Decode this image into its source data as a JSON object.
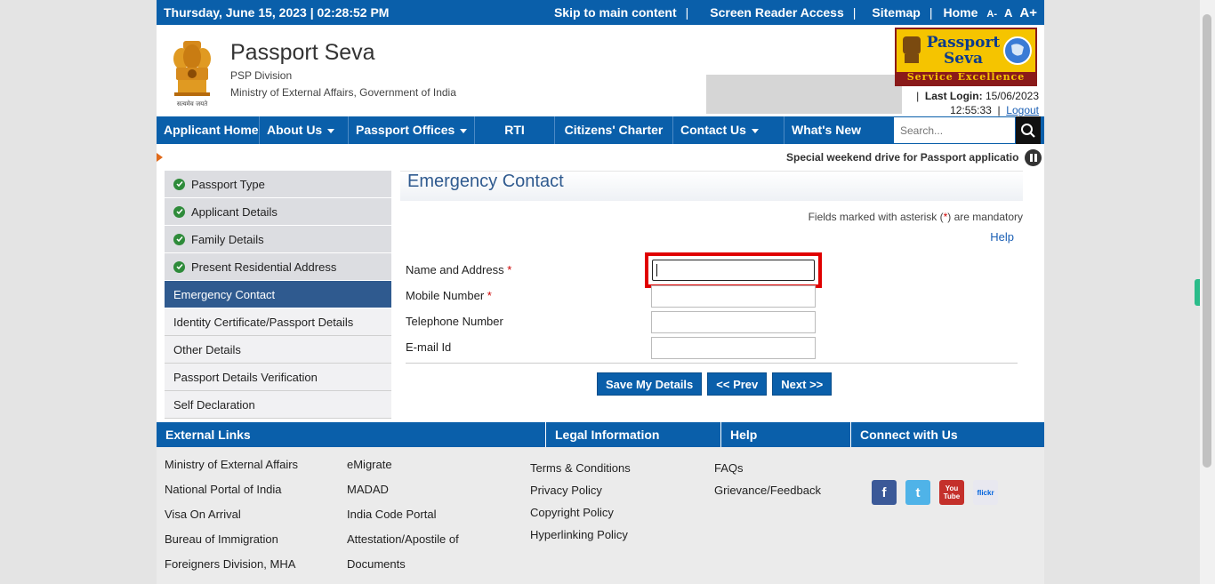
{
  "topbar": {
    "datetime": "Thursday,  June  15, 2023 | 02:28:52 PM",
    "skip": "Skip to main content",
    "screen_reader": "Screen Reader Access",
    "sitemap": "Sitemap",
    "home": "Home",
    "sep": "|",
    "font_small": "A-",
    "font_normal": "A",
    "font_large": "A+"
  },
  "header": {
    "title": "Passport Seva",
    "division": "PSP Division",
    "ministry": "Ministry of External Affairs, Government of India",
    "emblem_caption": "सत्यमेव जयते",
    "logo_line1": "Passport",
    "logo_line2": "Seva",
    "logo_band": "Service Excellence",
    "last_login_label": "Last Login:",
    "last_login_date": "15/06/2023",
    "last_login_time": "12:55:33",
    "logout": "Logout",
    "sep": "|"
  },
  "nav": {
    "items": [
      "Applicant Home",
      "About Us",
      "Passport Offices",
      "RTI",
      "Citizens' Charter",
      "Contact Us",
      "What's New"
    ],
    "search_placeholder": "Search..."
  },
  "ticker": {
    "message": "Special weekend drive for Passport applications"
  },
  "sidebar": {
    "items": [
      {
        "label": "Passport Type",
        "done": true
      },
      {
        "label": "Applicant Details",
        "done": true
      },
      {
        "label": "Family Details",
        "done": true
      },
      {
        "label": "Present Residential Address",
        "done": true
      },
      {
        "label": "Emergency Contact",
        "active": true
      },
      {
        "label": "Identity Certificate/Passport Details"
      },
      {
        "label": "Other Details"
      },
      {
        "label": "Passport Details Verification"
      },
      {
        "label": "Self Declaration"
      }
    ]
  },
  "form": {
    "title": "Emergency Contact",
    "mandatory_pre": "Fields marked with asterisk (",
    "mandatory_ast": "*",
    "mandatory_post": ") are mandatory",
    "help": "Help",
    "fields": [
      {
        "label": "Name and Address",
        "required": true,
        "value": ""
      },
      {
        "label": "Mobile Number",
        "required": true,
        "value": ""
      },
      {
        "label": "Telephone Number",
        "required": false,
        "value": ""
      },
      {
        "label": "E-mail Id",
        "required": false,
        "value": ""
      }
    ],
    "ast": "*",
    "buttons": {
      "save": "Save My Details",
      "prev": "<< Prev",
      "next": "Next >>"
    }
  },
  "footer": {
    "headings": [
      "External Links",
      "Legal Information",
      "Help",
      "Connect with Us"
    ],
    "external_col1": [
      "Ministry of External Affairs",
      "National Portal of India",
      "Visa On Arrival",
      "Bureau of Immigration",
      "Foreigners Division, MHA"
    ],
    "external_col2": [
      "eMigrate",
      "MADAD",
      "India Code Portal",
      "Attestation/Apostile of",
      "Documents"
    ],
    "legal": [
      "Terms & Conditions",
      "Privacy Policy",
      "Copyright Policy",
      "Hyperlinking Policy"
    ],
    "help": [
      "FAQs",
      "Grievance/Feedback"
    ],
    "social_icons": [
      "facebook-icon",
      "twitter-icon",
      "youtube-icon",
      "flickr-icon"
    ],
    "youtube_text": "You Tube",
    "flickr_text": "flickr"
  },
  "colors": {
    "brand_blue": "#0a5faa",
    "active_blue": "#2f5a8f",
    "highlight_red": "#e00000",
    "check_green": "#2e8b3a"
  }
}
